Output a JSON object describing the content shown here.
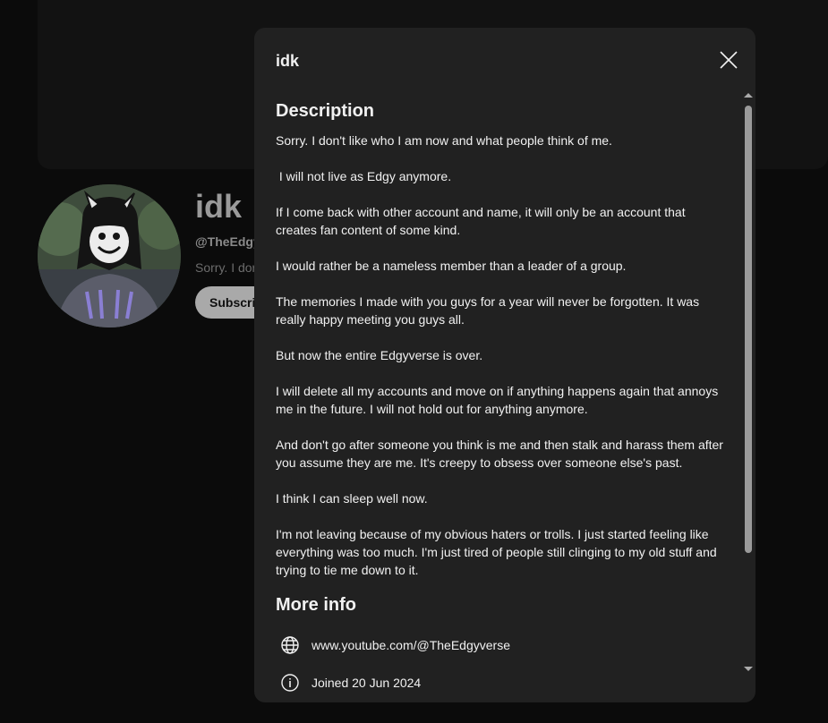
{
  "channel": {
    "name": "idk",
    "handle": "@TheEdgy",
    "description_preview": "Sorry. I dor",
    "subscribe_label": "Subscrib"
  },
  "dialog": {
    "title": "idk",
    "description_heading": "Description",
    "description_paragraphs": [
      "Sorry. I don't like who I am now and what people think of me.",
      " I will not live as Edgy anymore.",
      "If I come back with other account and name, it will only be an account that creates fan content of some kind.",
      "I would rather be a nameless member than a leader of a group.",
      "The memories I made with you guys for a year will never be forgotten. It was really happy meeting you guys all.",
      "But now the entire Edgyverse is over.",
      "I will delete all my accounts and move on if anything happens again that annoys me in the future. I will not hold out for anything anymore.",
      "And don't go after someone you think is me and then stalk and harass them after you assume they are me. It's creepy to obsess over someone else's past.",
      "I think I can sleep well now.",
      "I'm not leaving because of my obvious haters or trolls. I just started feeling like everything was too much. I'm just tired of people still clinging to my old stuff and trying to tie me down to it."
    ],
    "more_info_heading": "More info",
    "link": "www.youtube.com/@TheEdgyverse",
    "joined": "Joined 20 Jun 2024"
  },
  "icons": {
    "close": "close-icon",
    "link": "globe-icon",
    "joined": "info-icon"
  },
  "colors": {
    "dialog_bg": "#212121",
    "page_bg": "#0b0b0b",
    "text": "#f1f1f1"
  }
}
